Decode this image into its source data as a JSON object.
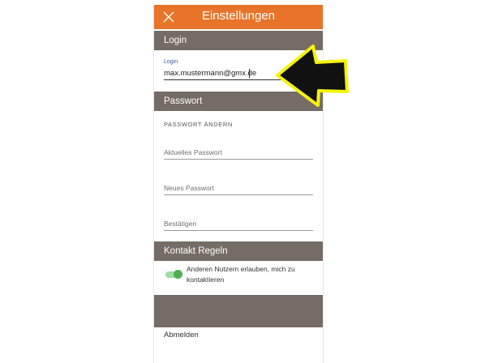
{
  "appbar": {
    "title": "Einstellungen",
    "close_icon": "close-icon"
  },
  "login_section": {
    "header": "Login",
    "field_label": "Login",
    "value": "max.mustermann@gmx.de"
  },
  "password_section": {
    "header": "Passwort",
    "subheading": "PASSWORT ÄNDERN",
    "current_placeholder": "Aktuelles Passwort",
    "new_placeholder": "Neues Passwort",
    "confirm_placeholder": "Bestätigen"
  },
  "contact_section": {
    "header": "Kontakt Regeln",
    "toggle_label": "Anderen Nutzern erlauben, mich zu kontaktieren",
    "toggle_on": true
  },
  "logout_label": "Abmelden",
  "colors": {
    "accent": "#e8742a",
    "section": "#746c65",
    "toggle": "#4caf50",
    "highlight_arrow": "#f5f20c"
  }
}
